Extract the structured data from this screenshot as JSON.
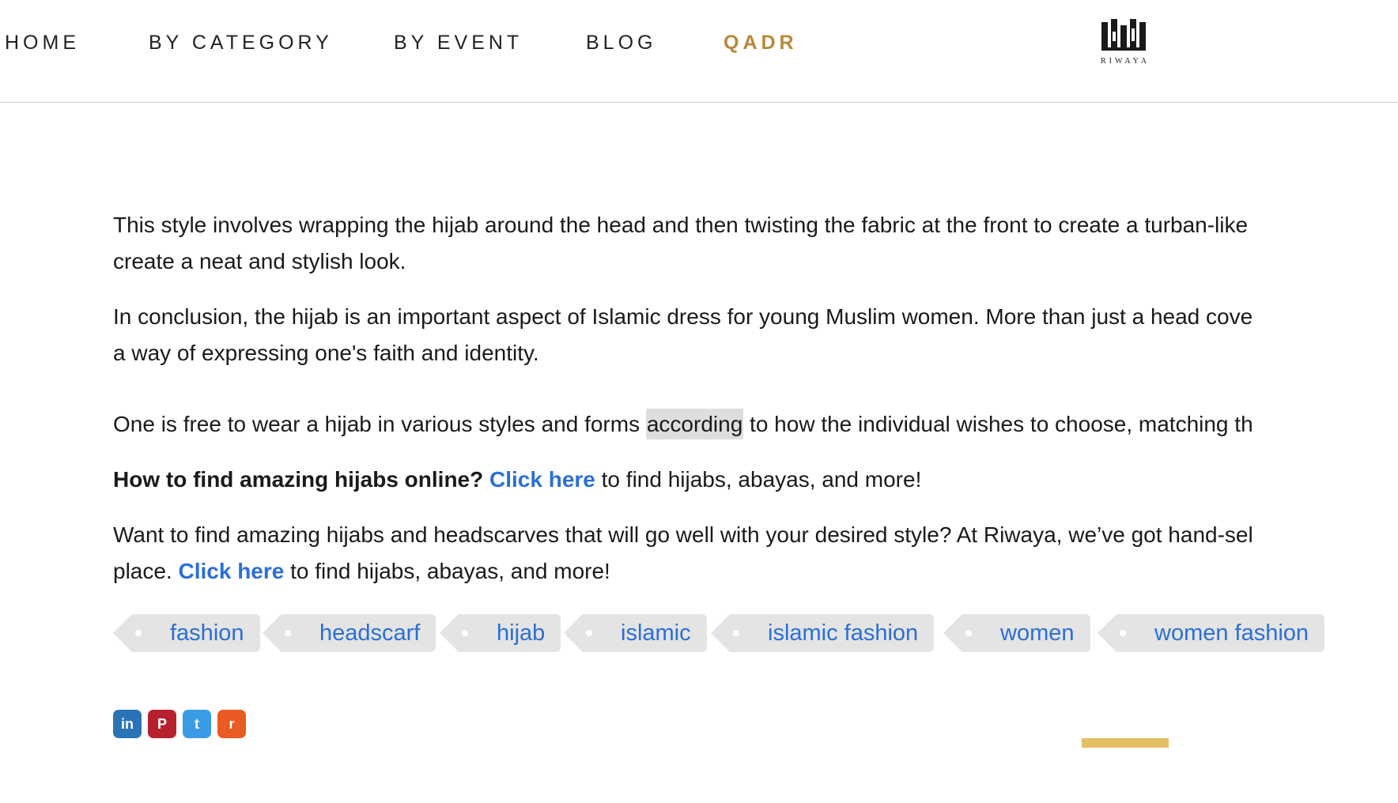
{
  "nav": {
    "items": [
      {
        "label": "HOME"
      },
      {
        "label": "BY CATEGORY"
      },
      {
        "label": "BY EVENT"
      },
      {
        "label": "BLOG"
      },
      {
        "label": "QADR"
      }
    ],
    "logo_text": "RIWAYA"
  },
  "article": {
    "p1_line1": "This style involves wrapping the hijab around the head and then twisting the fabric at the front to create a turban-like",
    "p1_line2": "create a neat and stylish look.",
    "p2_line1": "In conclusion, the hijab is an important aspect of Islamic dress for young Muslim women. More than just a head cove",
    "p2_line2": "a way of expressing one's faith and identity.",
    "p3_before": "One is free to wear a hijab in various styles and forms ",
    "p3_highlight": "according",
    "p3_after": " to how the individual wishes to choose, matching th",
    "p4_bold": "How to find amazing hijabs online?",
    "p4_link": "Click here",
    "p4_after": " to find hijabs, abayas, and more!",
    "p5_line1": "Want to find amazing hijabs and headscarves that will go well with your desired style? At Riwaya, we’ve got hand-sel",
    "p5_line2_before": "place. ",
    "p5_link": "Click here",
    "p5_after": " to find hijabs, abayas, and more!"
  },
  "tags": [
    {
      "label": "fashion"
    },
    {
      "label": "headscarf"
    },
    {
      "label": "hijab"
    },
    {
      "label": "islamic"
    },
    {
      "label": "islamic fashion"
    },
    {
      "label": "women"
    },
    {
      "label": "women fashion"
    }
  ],
  "share": {
    "linkedin": {
      "icon": "linkedin-icon",
      "glyph": "in",
      "color": "#2a73b6"
    },
    "pinterest": {
      "icon": "pinterest-icon",
      "glyph": "P",
      "color": "#b7202d"
    },
    "twitter": {
      "icon": "twitter-icon",
      "glyph": "t",
      "color": "#3a9be6"
    },
    "reddit": {
      "icon": "reddit-icon",
      "glyph": "r",
      "color": "#ea5a25"
    }
  },
  "colors": {
    "accent_gold": "#b8893a",
    "link_blue": "#2b6fd6",
    "tag_bg": "#e4e4e4",
    "bar_gold": "#e3c063"
  }
}
